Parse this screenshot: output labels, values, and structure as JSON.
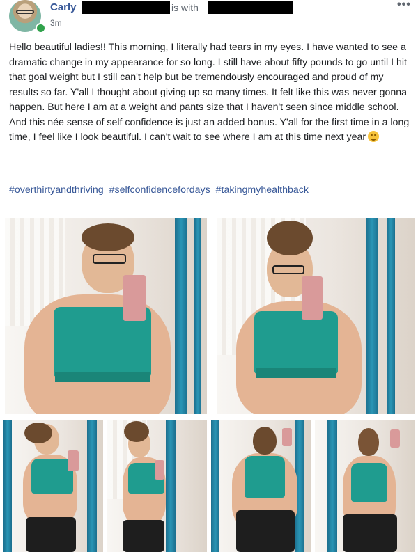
{
  "post": {
    "author": "Carly",
    "with_text": "is with",
    "time": "3m",
    "more": "•••",
    "body": "Hello beautiful ladies!! This morning, I literally had tears in my eyes. I have wanted to see a dramatic change in my appearance for so long. I still have about fifty pounds to go until I hit that goal weight but I still can't help but be tremendously encouraged and proud of my results so far. Y'all I thought about giving up so many times. It felt like this was never gonna happen. But here I am at a weight and pants size that I haven't seen since middle school. And this née sense of self confidence is just an added bonus. Y'all for the first time in a long time, I feel like I look beautiful. I can't wait to see where I am at this time next year",
    "hashtags": [
      "#overthirtyandthriving",
      "#selfconfidencefordays",
      "#takingmyhealthback"
    ]
  },
  "colors": {
    "link": "#385898",
    "online": "#31a24c",
    "top": "#1f9c8f",
    "mirror": "#2a95b5"
  },
  "photos": {
    "count": 6
  }
}
